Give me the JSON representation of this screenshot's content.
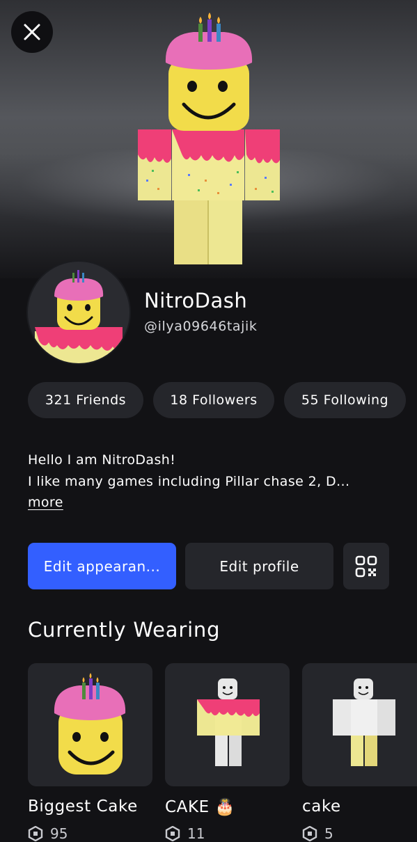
{
  "close_icon": "close-icon",
  "profile": {
    "display_name": "NitroDash",
    "username": "@ilya09646tajik"
  },
  "stats": {
    "friends": "321 Friends",
    "followers": "18 Followers",
    "following": "55 Following"
  },
  "bio": {
    "line1": "Hello I am NitroDash!",
    "line2": "I like many games including Pillar chase 2, D...",
    "more": "more"
  },
  "actions": {
    "edit_appearance": "Edit appearan...",
    "edit_profile": "Edit profile",
    "qr_icon": "qr-code-icon"
  },
  "currently_wearing": {
    "title": "Currently Wearing",
    "items": [
      {
        "name": "Biggest Cake",
        "price": "95"
      },
      {
        "name": "CAKE 🎂",
        "price": "11"
      },
      {
        "name": "cake",
        "price": "5"
      }
    ]
  },
  "colors": {
    "accent": "#335fff",
    "background": "#121215",
    "surface": "#25262b",
    "cake_frosting": "#ef3f77",
    "cake_body": "#ede792",
    "face_yellow": "#f2dc4a"
  }
}
